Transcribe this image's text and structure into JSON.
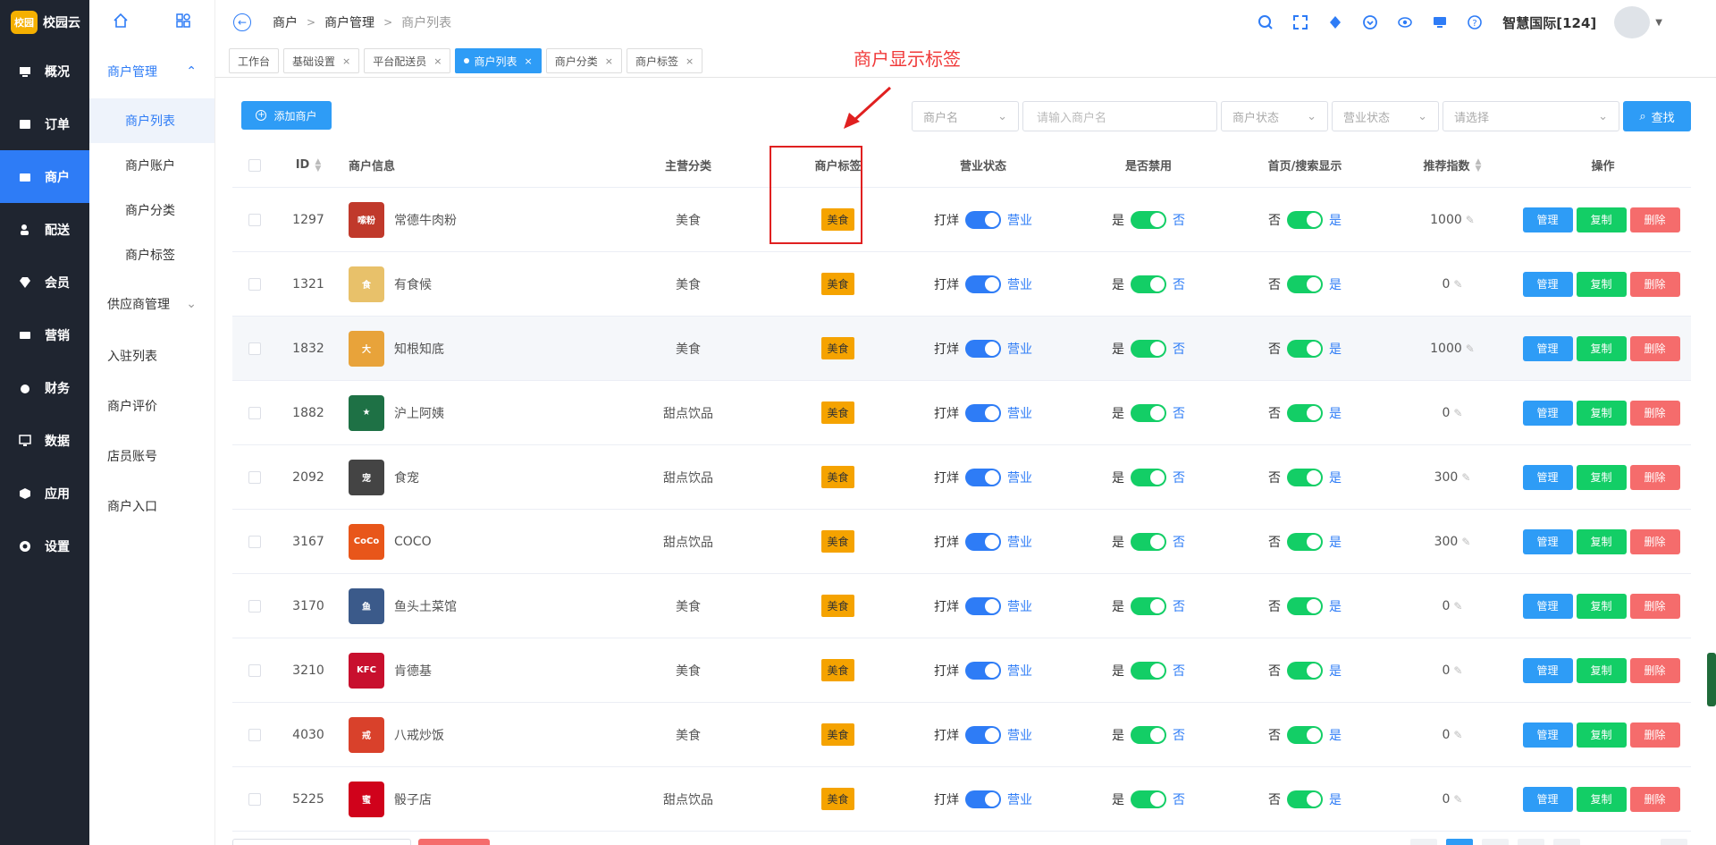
{
  "brand": {
    "logo_text": "校园",
    "name": "校园云"
  },
  "sidebar": {
    "items": [
      {
        "label": "概况",
        "icon": "overview-icon"
      },
      {
        "label": "订单",
        "icon": "order-icon"
      },
      {
        "label": "商户",
        "icon": "merchant-icon",
        "active": true
      },
      {
        "label": "配送",
        "icon": "delivery-icon"
      },
      {
        "label": "会员",
        "icon": "member-icon"
      },
      {
        "label": "营销",
        "icon": "marketing-icon"
      },
      {
        "label": "财务",
        "icon": "finance-icon"
      },
      {
        "label": "数据",
        "icon": "data-icon"
      },
      {
        "label": "应用",
        "icon": "app-icon"
      },
      {
        "label": "设置",
        "icon": "settings-icon"
      }
    ]
  },
  "subnav": {
    "group1": "商户管理",
    "items": [
      "商户列表",
      "商户账户",
      "商户分类",
      "商户标签"
    ],
    "group2": "供应商管理",
    "plain": [
      "入驻列表",
      "商户评价",
      "店员账号",
      "商户入口"
    ]
  },
  "breadcrumb": [
    "商户",
    "商户管理",
    "商户列表"
  ],
  "header": {
    "user": "智慧国际[124]"
  },
  "tabs": [
    {
      "label": "工作台",
      "closable": false
    },
    {
      "label": "基础设置",
      "closable": true
    },
    {
      "label": "平台配送员",
      "closable": true
    },
    {
      "label": "商户列表",
      "closable": true,
      "active": true
    },
    {
      "label": "商户分类",
      "closable": true
    },
    {
      "label": "商户标签",
      "closable": true
    }
  ],
  "annotation": "商户显示标签",
  "toolbar": {
    "add_label": "添加商户",
    "field_select": "商户名",
    "search_placeholder": "请输入商户名",
    "status_select": "商户状态",
    "business_select": "营业状态",
    "other_select": "请选择",
    "find_label": "查找"
  },
  "table": {
    "headers": {
      "id": "ID",
      "info": "商户信息",
      "category": "主营分类",
      "tag": "商户标签",
      "state": "营业状态",
      "disabled": "是否禁用",
      "home": "首页/搜索显示",
      "rec": "推荐指数",
      "op": "操作"
    },
    "switch_labels": {
      "closed": "打烊",
      "open": "营业",
      "yes": "是",
      "no": "否"
    },
    "op_labels": {
      "manage": "管理",
      "copy": "复制",
      "delete": "删除"
    },
    "rows": [
      {
        "id": "1297",
        "name": "常德牛肉粉",
        "category": "美食",
        "tag": "美食",
        "rec": "1000",
        "logo_text": "嗦粉",
        "logo_color": "#c0392b"
      },
      {
        "id": "1321",
        "name": "有食候",
        "category": "美食",
        "tag": "美食",
        "rec": "0",
        "logo_text": "食",
        "logo_color": "#e8c16a"
      },
      {
        "id": "1832",
        "name": "知根知底",
        "category": "美食",
        "tag": "美食",
        "rec": "1000",
        "logo_text": "大",
        "logo_color": "#e8a33a"
      },
      {
        "id": "1882",
        "name": "沪上阿姨",
        "category": "甜点饮品",
        "tag": "美食",
        "rec": "0",
        "logo_text": "★",
        "logo_color": "#1e7145"
      },
      {
        "id": "2092",
        "name": "食宠",
        "category": "甜点饮品",
        "tag": "美食",
        "rec": "300",
        "logo_text": "宠",
        "logo_color": "#444444"
      },
      {
        "id": "3167",
        "name": "COCO",
        "category": "甜点饮品",
        "tag": "美食",
        "rec": "300",
        "logo_text": "CoCo",
        "logo_color": "#e8561a"
      },
      {
        "id": "3170",
        "name": "鱼头土菜馆",
        "category": "美食",
        "tag": "美食",
        "rec": "0",
        "logo_text": "鱼",
        "logo_color": "#3b5a8a"
      },
      {
        "id": "3210",
        "name": "肯德基",
        "category": "美食",
        "tag": "美食",
        "rec": "0",
        "logo_text": "KFC",
        "logo_color": "#c8102e"
      },
      {
        "id": "4030",
        "name": "八戒炒饭",
        "category": "美食",
        "tag": "美食",
        "rec": "0",
        "logo_text": "戒",
        "logo_color": "#d9412b"
      },
      {
        "id": "5225",
        "name": "骰子店",
        "category": "甜点饮品",
        "tag": "美食",
        "rec": "0",
        "logo_text": "蜜",
        "logo_color": "#d0021b"
      }
    ]
  },
  "colors": {
    "primary": "#2e7cf6",
    "success": "#13ce66",
    "danger": "#f56c6c",
    "tag": "#f5a300",
    "sidebar": "#1f2530"
  }
}
